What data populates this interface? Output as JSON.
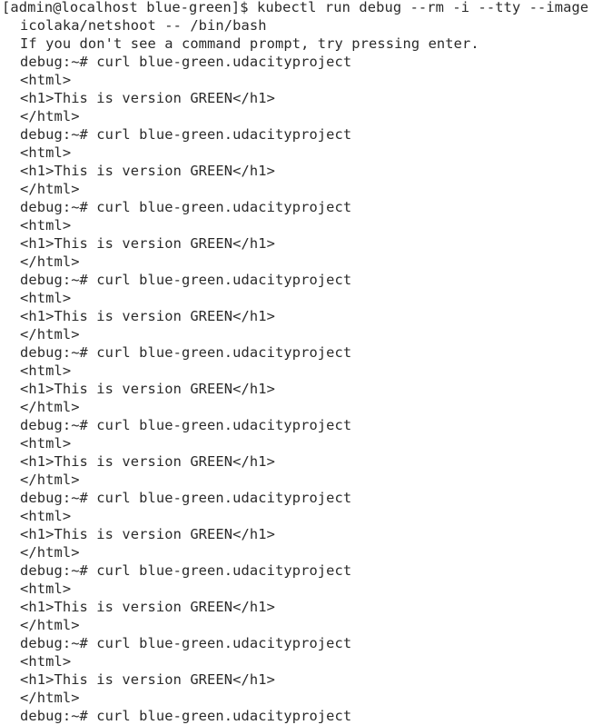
{
  "terminal": {
    "lines": [
      "[admin@localhost blue-green]$ kubectl run debug --rm -i --tty --image",
      "icolaka/netshoot -- /bin/bash",
      "If you don't see a command prompt, try pressing enter.",
      "debug:~# curl blue-green.udacityproject",
      "<html>",
      "<h1>This is version GREEN</h1>",
      "</html>",
      "debug:~# curl blue-green.udacityproject",
      "<html>",
      "<h1>This is version GREEN</h1>",
      "</html>",
      "debug:~# curl blue-green.udacityproject",
      "<html>",
      "<h1>This is version GREEN</h1>",
      "</html>",
      "debug:~# curl blue-green.udacityproject",
      "<html>",
      "<h1>This is version GREEN</h1>",
      "</html>",
      "debug:~# curl blue-green.udacityproject",
      "<html>",
      "<h1>This is version GREEN</h1>",
      "</html>",
      "debug:~# curl blue-green.udacityproject",
      "<html>",
      "<h1>This is version GREEN</h1>",
      "</html>",
      "debug:~# curl blue-green.udacityproject",
      "<html>",
      "<h1>This is version GREEN</h1>",
      "</html>",
      "debug:~# curl blue-green.udacityproject",
      "<html>",
      "<h1>This is version GREEN</h1>",
      "</html>",
      "debug:~# curl blue-green.udacityproject",
      "<html>",
      "<h1>This is version GREEN</h1>",
      "</html>",
      "debug:~# curl blue-green.udacityproject"
    ]
  }
}
